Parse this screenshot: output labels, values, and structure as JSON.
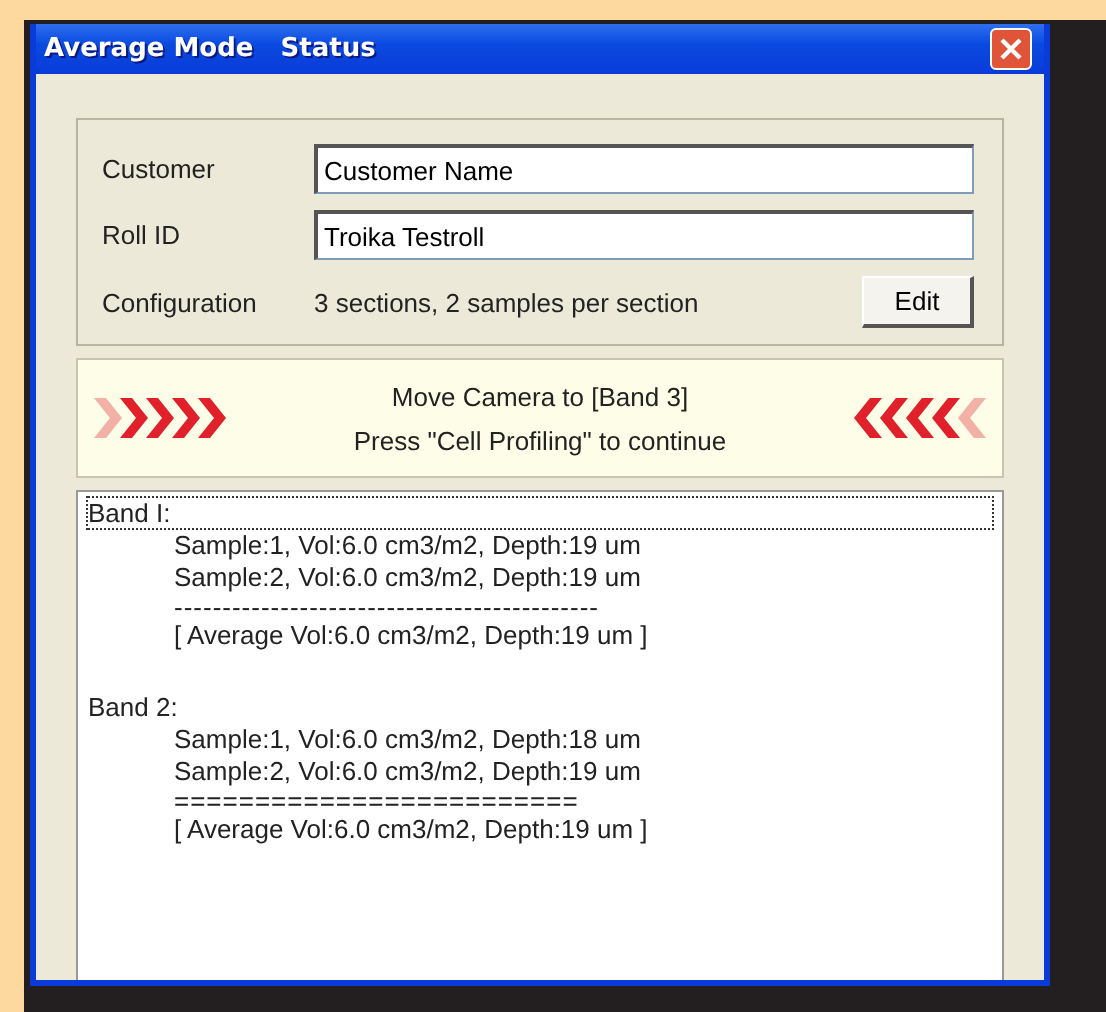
{
  "window": {
    "title": "Average Mode   Status"
  },
  "fields": [
    {
      "label": "Customer",
      "value": "Customer Name"
    },
    {
      "label": "Roll ID",
      "value": "Troika Testroll"
    }
  ],
  "configuration": {
    "label": "Configuration",
    "value": "3 sections, 2 samples per section",
    "button": "Edit"
  },
  "message": {
    "lines": [
      "Move Camera to [Band 3]",
      "Press \"Cell Profiling\" to continue"
    ]
  },
  "results": [
    {
      "title": "Band I:",
      "focused": true,
      "lines": [
        {
          "kind": "sample",
          "text": "Sample:1,  Vol:6.0 cm3/m2,  Depth:19 um"
        },
        {
          "kind": "sample",
          "text": "Sample:2,  Vol:6.0 cm3/m2,  Depth:19 um"
        },
        {
          "kind": "separator",
          "text": "--------------------------------------------"
        },
        {
          "kind": "average",
          "text": "[ Average  Vol:6.0 cm3/m2,  Depth:19 um ]"
        }
      ]
    },
    {
      "title": "Band 2:",
      "focused": false,
      "lines": [
        {
          "kind": "sample",
          "text": "Sample:1,  Vol:6.0 cm3/m2,  Depth:18 um"
        },
        {
          "kind": "sample",
          "text": "Sample:2,  Vol:6.0 cm3/m2,  Depth:19 um"
        },
        {
          "kind": "separator",
          "text": "========================="
        },
        {
          "kind": "average",
          "text": "[ Average  Vol:6.0 cm3/m2,  Depth:19 um ]"
        }
      ]
    }
  ]
}
